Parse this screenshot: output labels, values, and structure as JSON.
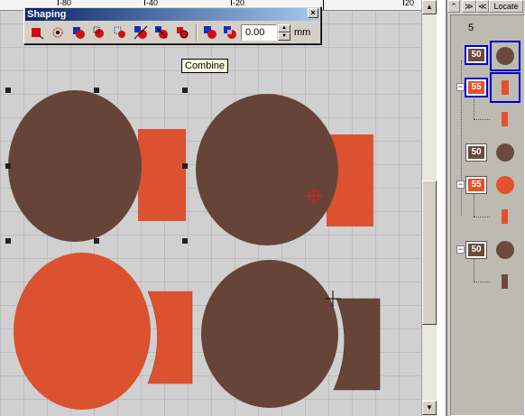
{
  "toolbar": {
    "title": "Shaping",
    "close_glyph": "×",
    "margin_value": "0.00",
    "unit": "mm",
    "spin_up": "▲",
    "spin_down": "▼",
    "tools": [
      "shape-red-square-icon",
      "shape-dotted-circle-icon",
      "shape-blue-red-combo-icon",
      "shape-circle-cut-icon",
      "shape-dotted-blue-icon",
      "shape-diagonal-icon",
      "shape-slash-icon",
      "shape-red-square-2-icon",
      "combine-icon",
      "combine-alt-icon"
    ]
  },
  "tooltip": {
    "text": "Combine"
  },
  "ruler": {
    "labels": [
      "-80",
      "-40",
      "-20",
      "20"
    ]
  },
  "panel": {
    "buttons": {
      "collapse": "≫",
      "expand": "≪",
      "locate": "Locate"
    },
    "count": "5",
    "items": [
      {
        "badge": "50",
        "color": "#6b4a3c",
        "shape": "circle",
        "selected": true
      },
      {
        "badge": "55",
        "color": "#e4512c",
        "shape": "rect",
        "selected": true,
        "expander": "−"
      },
      {
        "badge": "",
        "color": "#e4512c",
        "shape": "rect",
        "selected": false
      },
      {
        "badge": "50",
        "color": "#6b4a3c",
        "shape": "circle",
        "selected": false
      },
      {
        "badge": "55",
        "color": "#e4512c",
        "shape": "circle",
        "selected": false,
        "expander": "−"
      },
      {
        "badge": "",
        "color": "#e4512c",
        "shape": "rect",
        "selected": false
      },
      {
        "badge": "50",
        "color": "#6b4a3c",
        "shape": "circle",
        "selected": false,
        "expander": "−"
      },
      {
        "badge": "",
        "color": "#6b4a3c",
        "shape": "rect",
        "selected": false
      }
    ]
  },
  "colors": {
    "brown": "#6b4a3c",
    "orange": "#e4512c",
    "grid": "#b8b8b8",
    "accent": "#0a246a"
  }
}
